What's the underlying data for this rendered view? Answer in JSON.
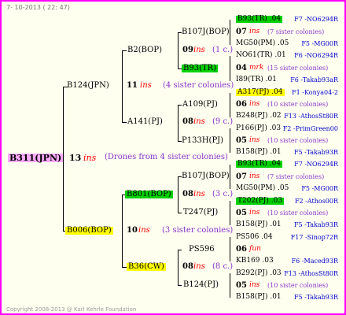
{
  "header": {
    "date": "7- 10-2013 ( 22: 47)"
  },
  "copyright": "Copyright 2008-2013 @ Karl Kehrle Foundation",
  "root": {
    "name": "B311(JPN)",
    "year": "13",
    "ins": "ins",
    "note": "(Drones from 4 sister colonies)"
  },
  "p1": {
    "name": "B124(JPN)",
    "year": "11",
    "ins": "ins",
    "note": "(4 sister colonies)"
  },
  "p2": {
    "name": "B006(BOP)",
    "year": "10",
    "ins": "ins",
    "note": "(3 sister colonies)"
  },
  "g1": {
    "name": "B2(BOP)",
    "year": "09",
    "ins": "ins",
    "note": "(1 c.)"
  },
  "g2": {
    "name": "A141(PJ)",
    "year": "08",
    "ins": "ins",
    "note": "(9 c.)"
  },
  "g3": {
    "name": "B801(BOP)",
    "year": "08",
    "ins": "ins",
    "note": "(3 c.)"
  },
  "g4": {
    "name": "B36(CW)",
    "year": "08",
    "ins": "ins",
    "note": "(8 c.)"
  },
  "gg": {
    "a": "B107J(BOP)",
    "b": "B93(TR)",
    "c": "A109(PJ)",
    "d": "P133H(PJ)",
    "e": "B107J(BOP)",
    "f": "T247(PJ)",
    "g": "PS596",
    "h": "B124(PJ)"
  },
  "right": [
    {
      "l": "B93(TR) .04",
      "r": "F7 -NO6294R"
    },
    {
      "y": "07",
      "i": "ins",
      "n": "(7 sister colonies)"
    },
    {
      "l": "MG50(PM) .05",
      "r": "F5 -MG00R"
    },
    {
      "l": "NO61(TR) .01",
      "r": "F6 -NO6294R"
    },
    {
      "y": "04",
      "i": "mrk",
      "n": "(15 sister colonies)"
    },
    {
      "l": "I89(TR) .01",
      "r": "F6 -Takab93aR"
    },
    {
      "l": "A317(PJ) .04",
      "r": "F1 -Konya04-2"
    },
    {
      "y": "06",
      "i": "ins",
      "n": "(10 sister colonies)"
    },
    {
      "l": "B248(PJ) .02",
      "r": "F13 -AthosSt80R"
    },
    {
      "l": "P166(PJ) .03",
      "r": "F2 -PrimGreen00"
    },
    {
      "y": "05",
      "i": "ins",
      "n": "(10 sister colonies)"
    },
    {
      "l": "B158(PJ) .01",
      "r": "F5 -Takab93R"
    },
    {
      "l": "B93(TR) .04",
      "r": "F7 -NO6294R"
    },
    {
      "y": "07",
      "i": "ins",
      "n": "(7 sister colonies)"
    },
    {
      "l": "MG50(PM) .05",
      "r": "F5 -MG00R"
    },
    {
      "l": "T202(PJ) .03",
      "r": "F2 -Athos00R"
    },
    {
      "y": "05",
      "i": "ins",
      "n": "(10 sister colonies)"
    },
    {
      "l": "B158(PJ) .01",
      "r": "F5 -Takab93R"
    },
    {
      "l": "PS506 .04",
      "r": "F17 -Sinop72R"
    },
    {
      "y": "06",
      "i": "fun",
      "n": ""
    },
    {
      "l": "KB169 .03",
      "r": "F6 -Maced93R"
    },
    {
      "l": "B292(PJ) .03",
      "r": "F13 -AthosSt80R"
    },
    {
      "y": "05",
      "i": "ins",
      "n": "(10 sister colonies)"
    },
    {
      "l": "B158(PJ) .01",
      "r": "F5 -Takab93R"
    }
  ]
}
